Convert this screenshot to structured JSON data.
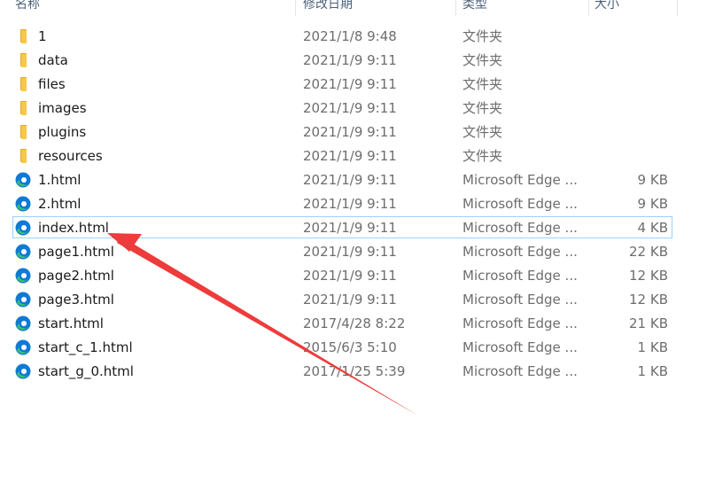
{
  "columns": {
    "name": "名称",
    "date": "修改日期",
    "type": "类型",
    "size": "大小"
  },
  "files": [
    {
      "name": "1",
      "date": "2021/1/8 9:48",
      "type": "文件夹",
      "size": "",
      "icon": "folder-icon"
    },
    {
      "name": "data",
      "date": "2021/1/9 9:11",
      "type": "文件夹",
      "size": "",
      "icon": "folder-icon"
    },
    {
      "name": "files",
      "date": "2021/1/9 9:11",
      "type": "文件夹",
      "size": "",
      "icon": "folder-icon"
    },
    {
      "name": "images",
      "date": "2021/1/9 9:11",
      "type": "文件夹",
      "size": "",
      "icon": "folder-icon"
    },
    {
      "name": "plugins",
      "date": "2021/1/9 9:11",
      "type": "文件夹",
      "size": "",
      "icon": "folder-icon"
    },
    {
      "name": "resources",
      "date": "2021/1/9 9:11",
      "type": "文件夹",
      "size": "",
      "icon": "folder-icon"
    },
    {
      "name": "1.html",
      "date": "2021/1/9 9:11",
      "type": "Microsoft Edge ...",
      "size": "9 KB",
      "icon": "edge-icon"
    },
    {
      "name": "2.html",
      "date": "2021/1/9 9:11",
      "type": "Microsoft Edge ...",
      "size": "9 KB",
      "icon": "edge-icon"
    },
    {
      "name": "index.html",
      "date": "2021/1/9 9:11",
      "type": "Microsoft Edge ...",
      "size": "4 KB",
      "icon": "edge-icon",
      "selected": true
    },
    {
      "name": "page1.html",
      "date": "2021/1/9 9:11",
      "type": "Microsoft Edge ...",
      "size": "22 KB",
      "icon": "edge-icon"
    },
    {
      "name": "page2.html",
      "date": "2021/1/9 9:11",
      "type": "Microsoft Edge ...",
      "size": "12 KB",
      "icon": "edge-icon"
    },
    {
      "name": "page3.html",
      "date": "2021/1/9 9:11",
      "type": "Microsoft Edge ...",
      "size": "12 KB",
      "icon": "edge-icon"
    },
    {
      "name": "start.html",
      "date": "2017/4/28 8:22",
      "type": "Microsoft Edge ...",
      "size": "21 KB",
      "icon": "edge-icon"
    },
    {
      "name": "start_c_1.html",
      "date": "2015/6/3 5:10",
      "type": "Microsoft Edge ...",
      "size": "1 KB",
      "icon": "edge-icon"
    },
    {
      "name": "start_g_0.html",
      "date": "2017/1/25 5:39",
      "type": "Microsoft Edge ...",
      "size": "1 KB",
      "icon": "edge-icon"
    }
  ],
  "colors": {
    "selection_border": "#99d1ff",
    "folder": "#f8c84a",
    "folder_dark": "#e3a92a",
    "edge_blue": "#0f7ad6",
    "edge_green": "#39c06e",
    "arrow": "#ee3b3b"
  },
  "annotation": {
    "type": "arrow",
    "points_to": "index.html"
  }
}
